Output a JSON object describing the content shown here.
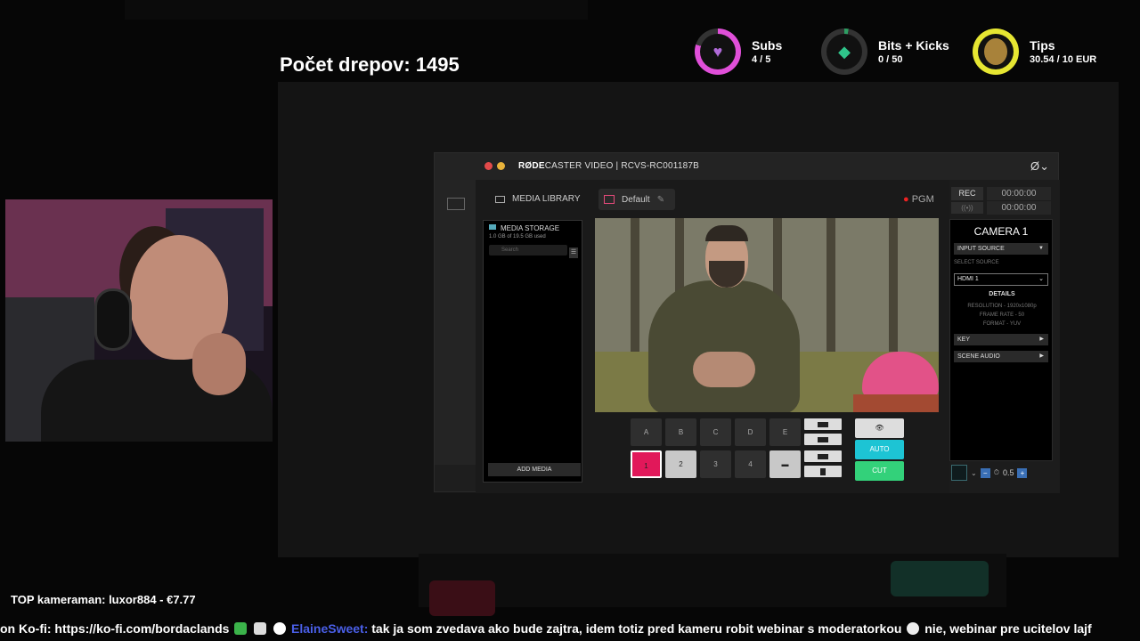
{
  "overlay": {
    "counter": "Počet drepov: 1495",
    "top_cameraman": "TOP kameraman: luxor884 - €7.77",
    "goals": [
      {
        "name": "Subs",
        "value": "4 / 5",
        "color": "#e04fd9",
        "icon": "heart-icon"
      },
      {
        "name": "Bits + Kicks",
        "value": "0 / 50",
        "color": "#2e9e63",
        "icon": "gem-icon"
      },
      {
        "name": "Tips",
        "value": "30.54 / 10 EUR",
        "color": "#e6e632",
        "icon": "coin-icon"
      }
    ],
    "ticker": {
      "prefix": "on Ko-fi: https://ko-fi.com/bordaclands",
      "username": "ElaineSweet:",
      "message": "tak ja som zvedava ako bude zajtra, idem totiz pred kameru robit webinar s moderatorkou",
      "message2": "nie, webinar pre ucitelov  lajf"
    }
  },
  "app": {
    "brand": "RØDE",
    "title": "CASTER VIDEO | RCVS-RC001187B",
    "media_library": "MEDIA LIBRARY",
    "scene": "Default",
    "pgm": "PGM",
    "rec": "REC",
    "rec_time": "00:00:00",
    "stream_time": "00:00:00",
    "storage": {
      "title": "MEDIA STORAGE",
      "usage": "1.0 GB of 19.5 GB used",
      "search_placeholder": "Search",
      "add_media": "ADD MEDIA"
    },
    "source_buttons_top": [
      "A",
      "B",
      "C",
      "D",
      "E"
    ],
    "source_buttons_bottom": [
      "1",
      "2",
      "3",
      "4",
      ""
    ],
    "controls": {
      "auto": "AUTO",
      "cut": "CUT"
    },
    "camera": {
      "title": "CAMERA 1",
      "input_source": "INPUT SOURCE",
      "select_source": "SELECT SOURCE",
      "selected": "HDMI 1",
      "details": "DETAILS",
      "resolution": "RESOLUTION - 1920x1080p",
      "frame_rate": "FRAME RATE - 50",
      "format": "FORMAT - YUV",
      "key": "KEY",
      "scene_audio": "SCENE AUDIO",
      "transition_value": "0.5"
    }
  }
}
